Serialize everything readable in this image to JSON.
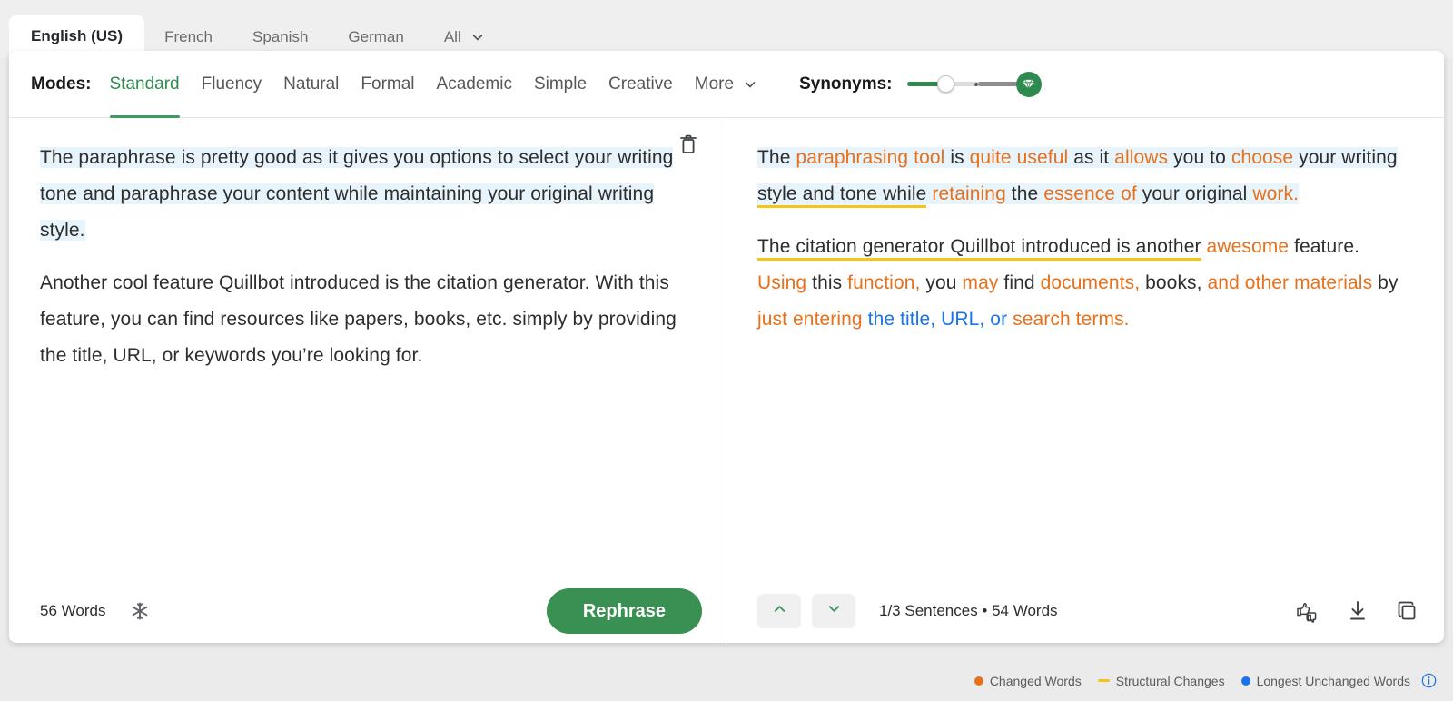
{
  "languages": {
    "tabs": [
      {
        "label": "English (US)",
        "active": true
      },
      {
        "label": "French",
        "active": false
      },
      {
        "label": "Spanish",
        "active": false
      },
      {
        "label": "German",
        "active": false
      }
    ],
    "all_label": "All",
    "all_icon": "chevron-down-icon"
  },
  "modes": {
    "label": "Modes:",
    "items": [
      {
        "label": "Standard",
        "active": true
      },
      {
        "label": "Fluency",
        "active": false
      },
      {
        "label": "Natural",
        "active": false
      },
      {
        "label": "Formal",
        "active": false
      },
      {
        "label": "Academic",
        "active": false
      },
      {
        "label": "Simple",
        "active": false
      },
      {
        "label": "Creative",
        "active": false
      },
      {
        "label": "More",
        "active": false
      }
    ],
    "more_icon": "chevron-down-icon"
  },
  "synonyms": {
    "label": "Synonyms:",
    "value_percent": 33,
    "premium_icon": "diamond-icon",
    "track_color": "#2e8b4f"
  },
  "input_panel": {
    "clear_icon": "trash-icon",
    "paragraph1": {
      "p1_a": "The paraphrase is pretty good as it gives you options to select your writing tone and paraphrase your content while maintaining your original writing style."
    },
    "paragraph2": "Another cool feature Quillbot introduced is the citation generator. With this feature, you can find resources like papers, books, etc. simply by providing the title, URL, or keywords you’re looking for.",
    "word_count": "56 Words",
    "freeze_icon": "snowflake-icon",
    "rephrase_label": "Rephrase"
  },
  "output_panel": {
    "paragraph1": [
      {
        "t": "The ",
        "c": "plain",
        "hl": true
      },
      {
        "t": "paraphrasing tool",
        "c": "changed",
        "hl": true
      },
      {
        "t": " is ",
        "c": "plain",
        "hl": true
      },
      {
        "t": "quite useful",
        "c": "changed",
        "hl": true
      },
      {
        "t": " as it ",
        "c": "plain",
        "hl": true
      },
      {
        "t": "allows",
        "c": "changed",
        "hl": true
      },
      {
        "t": " you to ",
        "c": "plain",
        "hl": true
      },
      {
        "t": "choose",
        "c": "changed",
        "hl": true
      },
      {
        "t": " your writing ",
        "c": "plain",
        "hl": true
      },
      {
        "t": "style and tone while",
        "c": "plain",
        "hl": true,
        "structural": true
      },
      {
        "t": " ",
        "c": "plain",
        "hl": true
      },
      {
        "t": "retaining",
        "c": "changed",
        "hl": true
      },
      {
        "t": " the ",
        "c": "plain",
        "hl": true
      },
      {
        "t": "essence of",
        "c": "changed",
        "hl": true
      },
      {
        "t": " your original ",
        "c": "plain",
        "hl": true
      },
      {
        "t": "work.",
        "c": "changed",
        "hl": true
      }
    ],
    "paragraph2": [
      {
        "t": "The citation generator Quillbot introduced is another",
        "c": "plain",
        "structural": true
      },
      {
        "t": " ",
        "c": "plain"
      },
      {
        "t": "awesome",
        "c": "changed"
      },
      {
        "t": " feature. ",
        "c": "plain"
      },
      {
        "t": "Using",
        "c": "changed"
      },
      {
        "t": " this ",
        "c": "plain"
      },
      {
        "t": "function,",
        "c": "changed"
      },
      {
        "t": " you ",
        "c": "plain"
      },
      {
        "t": "may",
        "c": "changed"
      },
      {
        "t": " find ",
        "c": "plain"
      },
      {
        "t": "documents,",
        "c": "changed"
      },
      {
        "t": " books, ",
        "c": "plain"
      },
      {
        "t": "and other materials",
        "c": "changed"
      },
      {
        "t": " by ",
        "c": "plain"
      },
      {
        "t": "just entering",
        "c": "changed"
      },
      {
        "t": " ",
        "c": "plain"
      },
      {
        "t": "the title, URL, or",
        "c": "unchanged"
      },
      {
        "t": " ",
        "c": "plain"
      },
      {
        "t": "search terms.",
        "c": "changed"
      }
    ],
    "prev_icon": "chevron-up-icon",
    "next_icon": "chevron-down-icon",
    "sentence_info": "1/3 Sentences  •  54 Words",
    "feedback_icon": "thumbs-up-down-icon",
    "download_icon": "download-icon",
    "copy_icon": "copy-icon"
  },
  "legend": {
    "items": [
      {
        "label": "Changed Words",
        "marker": "dot",
        "color": "#e8701a"
      },
      {
        "label": "Structural Changes",
        "marker": "dash",
        "color": "#f5c518"
      },
      {
        "label": "Longest Unchanged Words",
        "marker": "dot",
        "color": "#1a73e8"
      }
    ],
    "info_icon": "info-icon"
  }
}
